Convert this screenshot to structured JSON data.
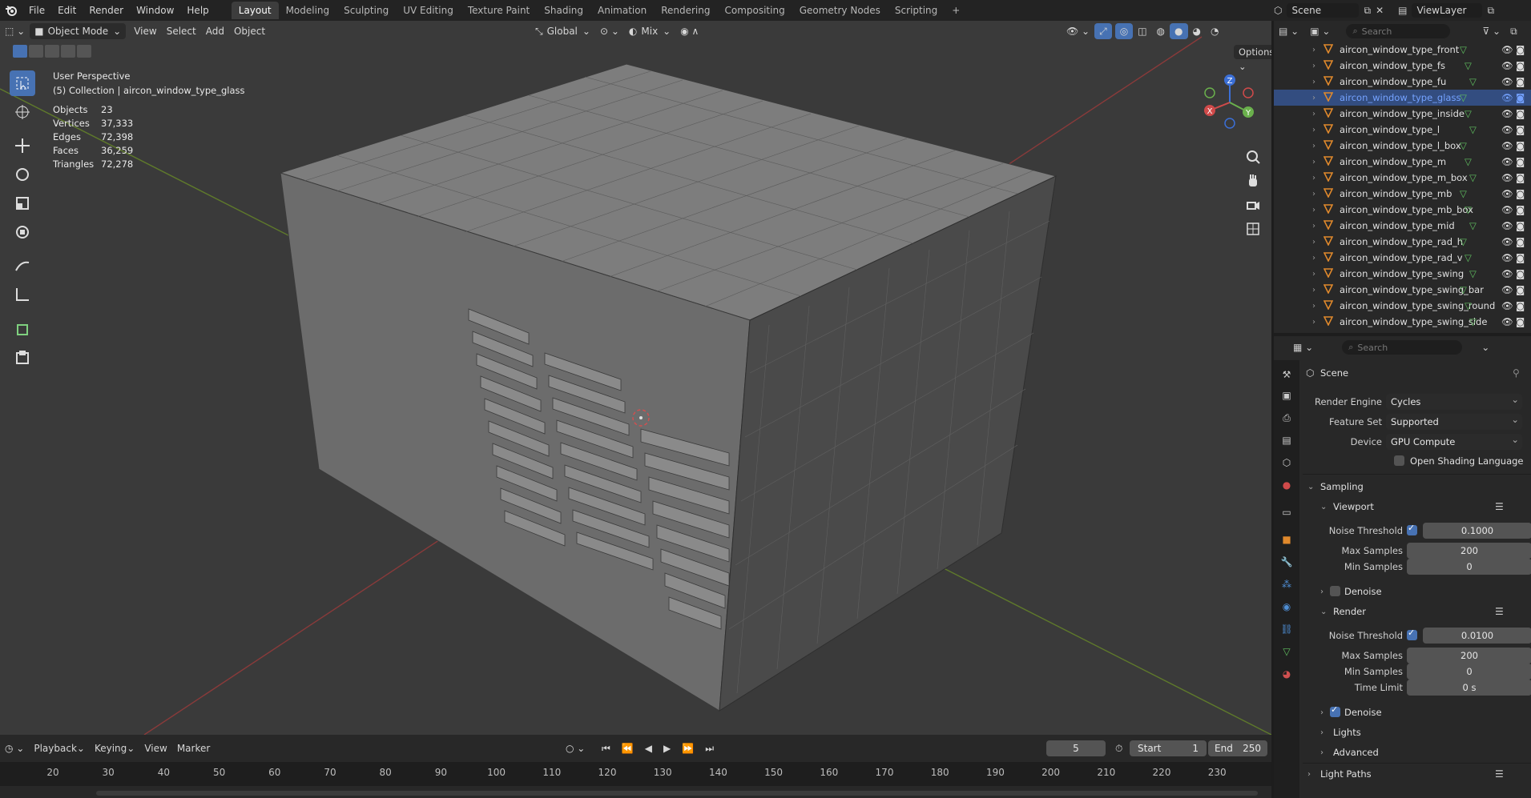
{
  "menubar": {
    "items": [
      "File",
      "Edit",
      "Render",
      "Window",
      "Help"
    ],
    "workspaces": [
      "Layout",
      "Modeling",
      "Sculpting",
      "UV Editing",
      "Texture Paint",
      "Shading",
      "Animation",
      "Rendering",
      "Compositing",
      "Geometry Nodes",
      "Scripting"
    ],
    "active_workspace": "Layout",
    "scene": "Scene",
    "view_layer": "ViewLayer"
  },
  "viewport": {
    "mode": "Object Mode",
    "menus": [
      "View",
      "Select",
      "Add",
      "Object"
    ],
    "orientation": "Global",
    "blend": "Mix",
    "options": "Options",
    "perspective": "User Perspective",
    "collection_line": "(5) Collection | aircon_window_type_glass",
    "stats": [
      {
        "label": "Objects",
        "value": "23"
      },
      {
        "label": "Vertices",
        "value": "37,333"
      },
      {
        "label": "Edges",
        "value": "72,398"
      },
      {
        "label": "Faces",
        "value": "36,259"
      },
      {
        "label": "Triangles",
        "value": "72,278"
      }
    ],
    "gizmo": {
      "x": "X",
      "y": "Y",
      "z": "Z"
    }
  },
  "timeline": {
    "menus": [
      "Playback",
      "Keying",
      "View",
      "Marker"
    ],
    "current_frame": "5",
    "start_label": "Start",
    "start": "1",
    "end_label": "End",
    "end": "250",
    "ticks": [
      "20",
      "30",
      "40",
      "50",
      "60",
      "70",
      "80",
      "90",
      "100",
      "110",
      "120",
      "130",
      "140",
      "150",
      "160",
      "170",
      "180",
      "190",
      "200",
      "210",
      "220",
      "230"
    ]
  },
  "outliner": {
    "search_placeholder": "Search",
    "items": [
      {
        "name": "aircon_window_type_front",
        "selected": false
      },
      {
        "name": "aircon_window_type_fs",
        "selected": false
      },
      {
        "name": "aircon_window_type_fu",
        "selected": false
      },
      {
        "name": "aircon_window_type_glass",
        "selected": true
      },
      {
        "name": "aircon_window_type_inside",
        "selected": false
      },
      {
        "name": "aircon_window_type_l",
        "selected": false
      },
      {
        "name": "aircon_window_type_l_box",
        "selected": false
      },
      {
        "name": "aircon_window_type_m",
        "selected": false
      },
      {
        "name": "aircon_window_type_m_box",
        "selected": false
      },
      {
        "name": "aircon_window_type_mb",
        "selected": false
      },
      {
        "name": "aircon_window_type_mb_box",
        "selected": false
      },
      {
        "name": "aircon_window_type_mid",
        "selected": false
      },
      {
        "name": "aircon_window_type_rad_h",
        "selected": false
      },
      {
        "name": "aircon_window_type_rad_v",
        "selected": false
      },
      {
        "name": "aircon_window_type_swing",
        "selected": false
      },
      {
        "name": "aircon_window_type_swing_bar",
        "selected": false
      },
      {
        "name": "aircon_window_type_swing_round",
        "selected": false
      },
      {
        "name": "aircon_window_type_swing_side",
        "selected": false
      }
    ]
  },
  "properties": {
    "search_placeholder": "Search",
    "context": "Scene",
    "render_engine_label": "Render Engine",
    "render_engine": "Cycles",
    "feature_set_label": "Feature Set",
    "feature_set": "Supported",
    "device_label": "Device",
    "device": "GPU Compute",
    "osl_label": "Open Shading Language",
    "sampling": {
      "title": "Sampling",
      "viewport_title": "Viewport",
      "vp_noise_label": "Noise Threshold",
      "vp_noise": "0.1000",
      "vp_max_label": "Max Samples",
      "vp_max": "200",
      "vp_min_label": "Min Samples",
      "vp_min": "0",
      "vp_denoise": "Denoise",
      "render_title": "Render",
      "r_noise_label": "Noise Threshold",
      "r_noise": "0.0100",
      "r_max_label": "Max Samples",
      "r_max": "200",
      "r_min_label": "Min Samples",
      "r_min": "0",
      "r_time_label": "Time Limit",
      "r_time": "0 s",
      "r_denoise": "Denoise",
      "lights": "Lights",
      "advanced": "Advanced"
    },
    "light_paths": "Light Paths"
  }
}
